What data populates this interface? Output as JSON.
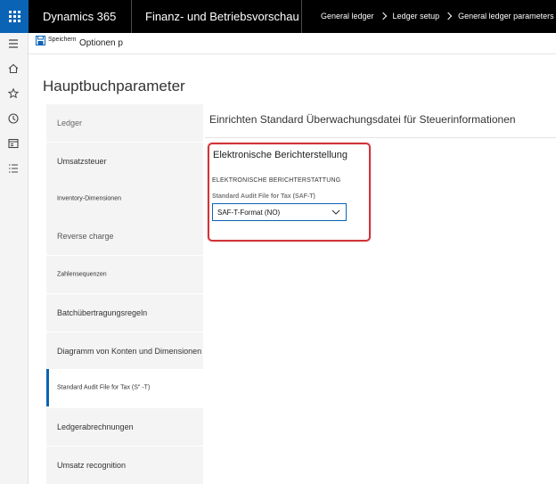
{
  "topbar": {
    "brand": "Dynamics 365",
    "module": "Finanz- und Betriebsvorschau",
    "breadcrumbs": [
      "General ledger",
      "Ledger setup",
      "General ledger parameters"
    ]
  },
  "rail": {
    "icons": [
      "hamburger-icon",
      "home-icon",
      "star-icon",
      "clock-icon",
      "workspace-icon",
      "list-icon"
    ]
  },
  "actions": {
    "save_label": "Speichern",
    "options_label": "Optionen p"
  },
  "page_title": "Hauptbuchparameter",
  "tabs": [
    {
      "label": "Ledger"
    },
    {
      "label": "Umsatzsteuer"
    },
    {
      "label": "Inventory-Dimensionen"
    },
    {
      "label": "Reverse charge"
    },
    {
      "label": "Zahlensequenzen"
    },
    {
      "label": "Batchübertragungsregeln"
    },
    {
      "label": "Diagramm von Konten und Dimensionen"
    },
    {
      "label": "Standard Audit File for Tax (S\" -T)"
    },
    {
      "label": "Ledgerabrechnungen"
    },
    {
      "label": "Umsatz recognition"
    }
  ],
  "content": {
    "section_title": "Einrichten Standard Überwachungsdatei für Steuerinformationen",
    "group_title": "Elektronische Berichterstellung",
    "group_caption": "ELEKTRONISCHE BERICHTERSTATTUNG",
    "field_label": "Standard Audit File for Tax (SAF-T)",
    "field_value": "SAF-T-Format (NO)"
  },
  "colors": {
    "accent": "#0a63b4",
    "highlight": "#d13438",
    "topbar": "#000000"
  }
}
